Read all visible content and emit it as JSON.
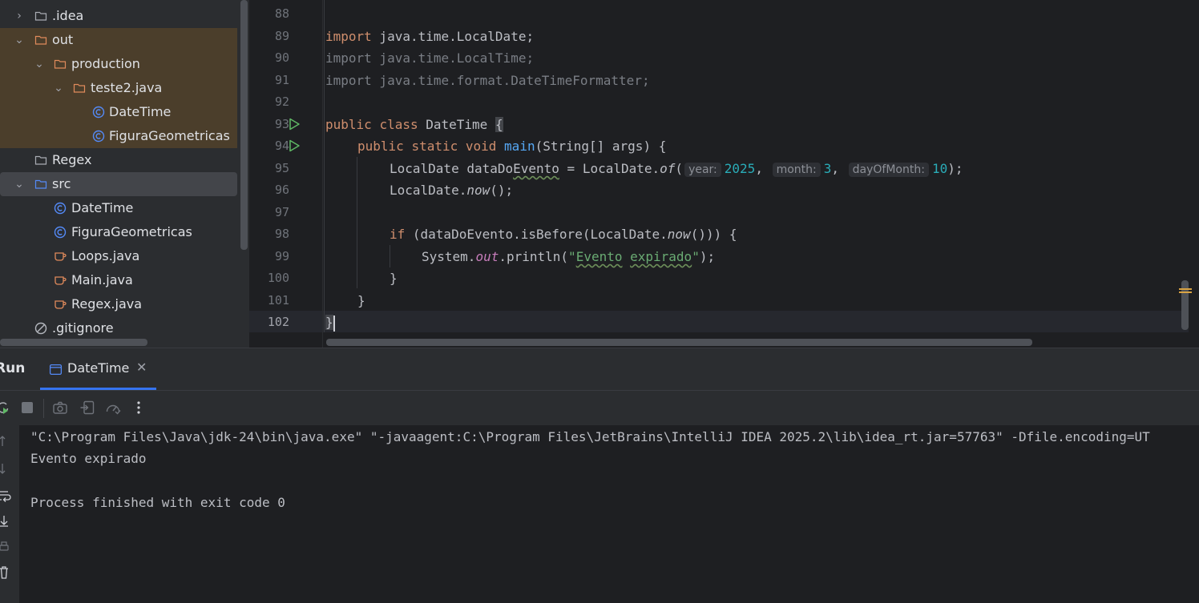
{
  "project_tree": {
    "items": [
      {
        "label": ".idea",
        "icon": "folder-icon",
        "expanded": false
      },
      {
        "label": "out",
        "icon": "folder-icon",
        "expanded": true
      },
      {
        "label": "production",
        "icon": "folder-icon",
        "expanded": true
      },
      {
        "label": "teste2.java",
        "icon": "folder-icon",
        "expanded": true
      },
      {
        "label": "DateTime",
        "icon": "class-icon"
      },
      {
        "label": "FiguraGeometricas",
        "icon": "class-icon"
      },
      {
        "label": "Regex",
        "icon": "folder-icon"
      },
      {
        "label": "src",
        "icon": "source-folder-icon",
        "expanded": true
      },
      {
        "label": "DateTime",
        "icon": "class-icon"
      },
      {
        "label": "FiguraGeometricas",
        "icon": "class-icon"
      },
      {
        "label": "Loops.java",
        "icon": "java-file-icon"
      },
      {
        "label": "Main.java",
        "icon": "java-file-icon"
      },
      {
        "label": "Regex.java",
        "icon": "java-file-icon"
      },
      {
        "label": ".gitignore",
        "icon": "ignored-file-icon"
      }
    ]
  },
  "editor": {
    "line_numbers": [
      "88",
      "89",
      "90",
      "91",
      "92",
      "93",
      "94",
      "95",
      "96",
      "97",
      "98",
      "99",
      "100",
      "101",
      "102"
    ],
    "current_line": "102",
    "code": {
      "l89": {
        "kw": "import",
        "rest": " java.time.LocalDate;"
      },
      "l90": {
        "text": "import java.time.LocalTime;"
      },
      "l91": {
        "text": "import java.time.format.DateTimeFormatter;"
      },
      "l93": {
        "kw1": "public",
        "kw2": "class",
        "name": "DateTime ",
        "brace": "{"
      },
      "l94": {
        "kw1": "public",
        "kw2": "static",
        "kw3": "void",
        "fn": "main",
        "rest": "(String[] args) {"
      },
      "l95": {
        "a": "LocalDate ",
        "b": "dataDo",
        "c": "Evento",
        "d": " = LocalDate.",
        "e": "of",
        "f": "(",
        "hint1": "year:",
        "v1": "2025",
        "s1": ", ",
        "hint2": "month:",
        "v2": "3",
        "s2": ", ",
        "hint3": "dayOfMonth:",
        "v3": "10",
        "end": ");"
      },
      "l96": {
        "a": "LocalDate.",
        "b": "now",
        "c": "();"
      },
      "l98": {
        "kw": "if",
        "a": " (dataDoEvento.isBefore(LocalDate.",
        "b": "now",
        "c": "())) {"
      },
      "l99": {
        "a": "System.",
        "b": "out",
        "c": ".println(",
        "q1": "\"",
        "w1": "Evento",
        "sp": " ",
        "w2": "expirado",
        "q2": "\"",
        "d": ");"
      },
      "l100": {
        "text": "}"
      },
      "l101": {
        "text": "}"
      },
      "l102": {
        "text": "}"
      }
    }
  },
  "run_panel": {
    "title": "Run",
    "tab_label": "DateTime",
    "toolbar_icons": [
      "rerun-icon",
      "stop-icon",
      "camera-icon",
      "restore-layout-icon",
      "coverage-icon",
      "more-options-icon"
    ],
    "console_lines": [
      "\"C:\\Program Files\\Java\\jdk-24\\bin\\java.exe\" \"-javaagent:C:\\Program Files\\JetBrains\\IntelliJ IDEA 2025.2\\lib\\idea_rt.jar=57763\" -Dfile.encoding=UT",
      "Evento expirado",
      "",
      "Process finished with exit code 0"
    ]
  },
  "colors": {
    "keyword": "#cf8e6d",
    "function": "#56a8f5",
    "number": "#2aacb8",
    "string": "#6aab73",
    "static_field": "#c77dbb",
    "excluded_folder_bg": "#4b3e2b",
    "accent": "#3574f0"
  }
}
